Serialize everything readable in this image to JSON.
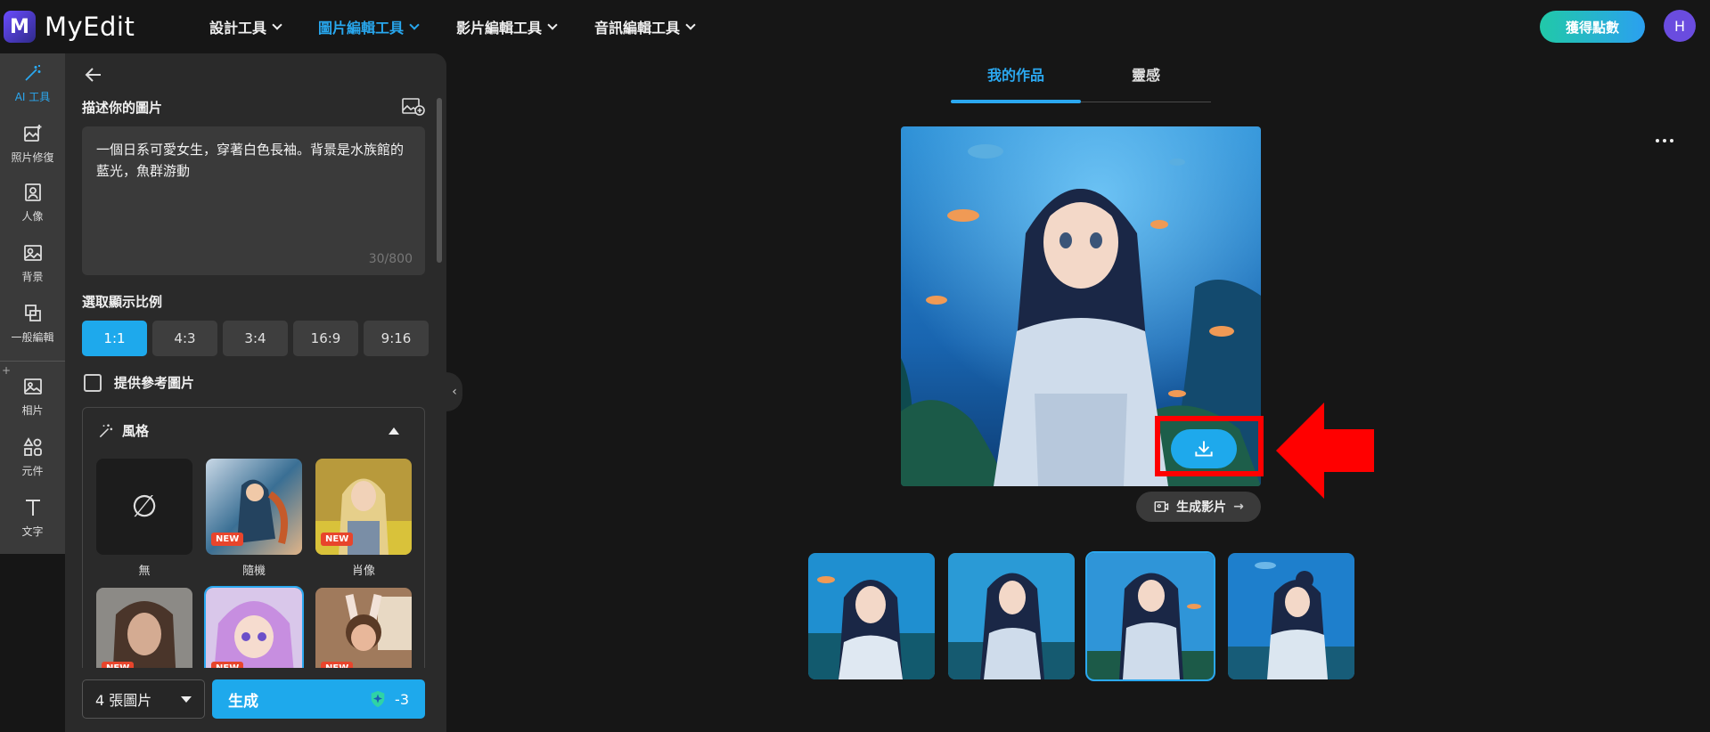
{
  "app": {
    "name": "MyEdit",
    "logo_letter": "M"
  },
  "topnav": {
    "items": [
      {
        "label": "設計工具",
        "active": false
      },
      {
        "label": "圖片編輯工具",
        "active": true
      },
      {
        "label": "影片編輯工具",
        "active": false
      },
      {
        "label": "音訊編輯工具",
        "active": false
      }
    ],
    "points_button": "獲得點數",
    "avatar_letter": "H"
  },
  "rail": {
    "items": [
      {
        "label": "AI 工具",
        "icon": "magic-wand-icon",
        "active": true
      },
      {
        "label": "照片修復",
        "icon": "photo-repair-icon"
      },
      {
        "label": "人像",
        "icon": "portrait-icon"
      },
      {
        "label": "背景",
        "icon": "background-icon"
      },
      {
        "label": "一般編輯",
        "icon": "crop-icon"
      },
      {
        "label": "相片",
        "icon": "photo-icon"
      },
      {
        "label": "元件",
        "icon": "shapes-icon"
      },
      {
        "label": "文字",
        "icon": "text-icon"
      }
    ],
    "plus": "+"
  },
  "panel": {
    "describe_title": "描述你的圖片",
    "prompt_text": "一個日系可愛女生，穿著白色長袖。背景是水族館的藍光，魚群游動",
    "prompt_count": "30/800",
    "ratio_title": "選取顯示比例",
    "ratios": [
      {
        "label": "1:1",
        "active": true
      },
      {
        "label": "4:3"
      },
      {
        "label": "3:4"
      },
      {
        "label": "16:9"
      },
      {
        "label": "9:16"
      }
    ],
    "reference_label": "提供參考圖片",
    "style_title": "風格",
    "styles": [
      {
        "label": "無",
        "new": false,
        "symbol": "∅"
      },
      {
        "label": "隨機",
        "new": true
      },
      {
        "label": "肖像",
        "new": true
      },
      {
        "label": "",
        "new": true
      },
      {
        "label": "",
        "new": true,
        "selected": true
      },
      {
        "label": "",
        "new": true
      }
    ],
    "new_badge": "NEW",
    "count_select": "4 張圖片",
    "generate_label": "生成",
    "generate_cost": "-3"
  },
  "main": {
    "tabs": [
      {
        "label": "我的作品",
        "active": true
      },
      {
        "label": "靈感",
        "active": false
      }
    ],
    "generate_video": "生成影片",
    "thumbnails_count": 4,
    "selected_thumbnail": 3,
    "colors": {
      "accent": "#1ea9ec",
      "highlight": "#ff0000"
    }
  }
}
